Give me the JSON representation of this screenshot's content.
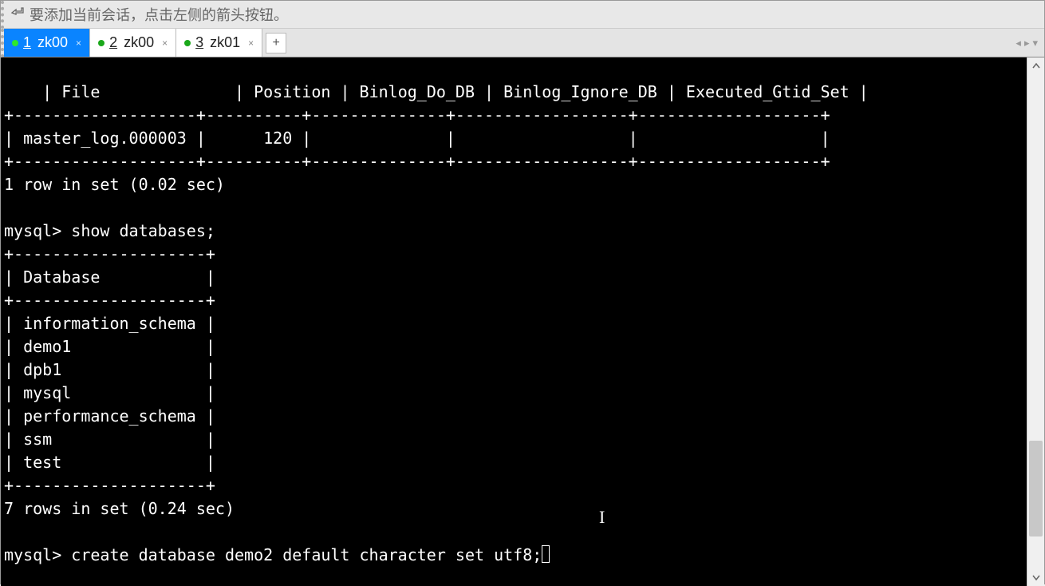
{
  "hint_text": "要添加当前会话，点击左侧的箭头按钮。",
  "tabs": [
    {
      "num": "1",
      "label": "zk00",
      "active": true
    },
    {
      "num": "2",
      "label": "zk00",
      "active": false
    },
    {
      "num": "3",
      "label": "zk01",
      "active": false
    }
  ],
  "terminal_lines": [
    "| File              | Position | Binlog_Do_DB | Binlog_Ignore_DB | Executed_Gtid_Set |",
    "+-------------------+----------+--------------+------------------+-------------------+",
    "| master_log.000003 |      120 |              |                  |                   |",
    "+-------------------+----------+--------------+------------------+-------------------+",
    "1 row in set (0.02 sec)",
    "",
    "mysql> show databases;",
    "+--------------------+",
    "| Database           |",
    "+--------------------+",
    "| information_schema |",
    "| demo1              |",
    "| dpb1               |",
    "| mysql              |",
    "| performance_schema |",
    "| ssm                |",
    "| test               |",
    "+--------------------+",
    "7 rows in set (0.24 sec)",
    ""
  ],
  "prompt_line_prefix": "mysql> create database demo2 default character set utf8;"
}
